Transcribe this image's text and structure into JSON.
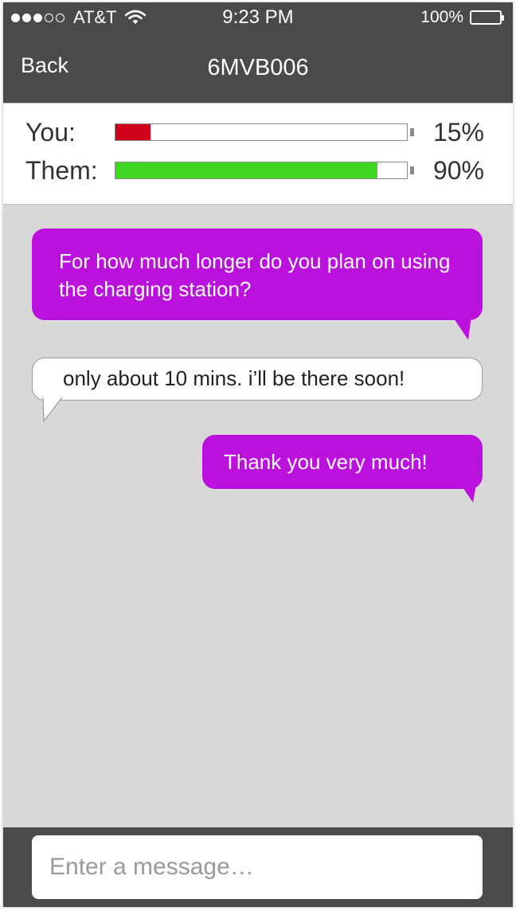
{
  "status_bar": {
    "carrier": "AT&T",
    "time": "9:23 PM",
    "battery_text": "100%",
    "signal_bars_full": 3,
    "signal_bars_total": 5
  },
  "nav": {
    "back_label": "Back",
    "title": "6MVB006"
  },
  "charge": {
    "you": {
      "label": "You:",
      "percent_text": "15%",
      "level": 0.12,
      "color": "#d0021b"
    },
    "them": {
      "label": "Them:",
      "percent_text": "90%",
      "level": 0.9,
      "color": "#3fd624"
    }
  },
  "messages": [
    {
      "direction": "outgoing",
      "text": "For how much longer do you plan on using the charging station?"
    },
    {
      "direction": "incoming",
      "text": "only about 10 mins. i’ll be there soon!"
    },
    {
      "direction": "outgoing",
      "text": "Thank you very much!"
    }
  ],
  "composer": {
    "placeholder": "Enter a message…"
  },
  "colors": {
    "bar_background": "#4a4a4a",
    "chat_background": "#d8d8d8",
    "outgoing_bubble": "#bb11dd",
    "incoming_bubble": "#ffffff"
  }
}
